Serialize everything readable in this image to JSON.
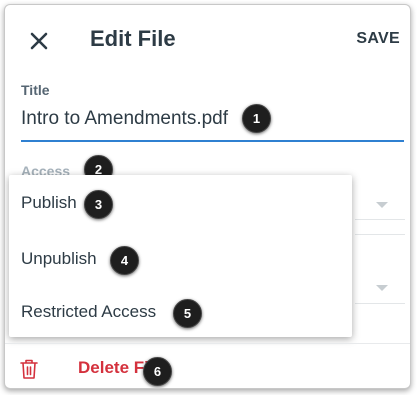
{
  "header": {
    "title": "Edit File",
    "save_label": "SAVE",
    "close_icon": "close-icon"
  },
  "form": {
    "title_label": "Title",
    "title_value": "Intro to Amendments.pdf",
    "access_label": "Access"
  },
  "access_menu": {
    "items": [
      {
        "label": "Publish"
      },
      {
        "label": "Unpublish"
      },
      {
        "label": "Restricted Access"
      }
    ]
  },
  "footer": {
    "delete_label": "Delete File",
    "delete_icon": "trash-icon",
    "delete_color": "#d4313d"
  },
  "callouts": [
    "1",
    "2",
    "3",
    "4",
    "5",
    "6"
  ],
  "colors": {
    "text": "#2d3b45",
    "accent": "#2f80d1",
    "danger": "#d4313d"
  }
}
